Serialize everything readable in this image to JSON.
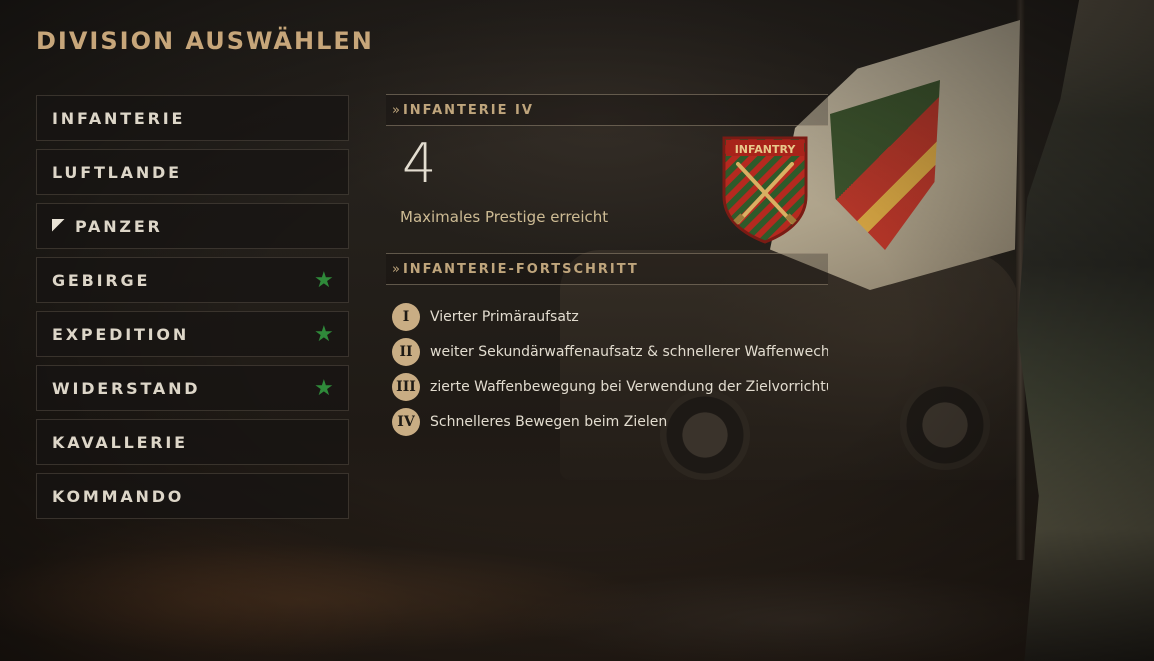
{
  "page": {
    "title": "DIVISION AUSWÄHLEN"
  },
  "menu": {
    "items": [
      {
        "label": "INFANTERIE",
        "selected": false,
        "starred": false
      },
      {
        "label": "LUFTLANDE",
        "selected": false,
        "starred": false
      },
      {
        "label": "PANZER",
        "selected": true,
        "starred": false
      },
      {
        "label": "GEBIRGE",
        "selected": false,
        "starred": true
      },
      {
        "label": "EXPEDITION",
        "selected": false,
        "starred": true
      },
      {
        "label": "WIDERSTAND",
        "selected": false,
        "starred": true
      },
      {
        "label": "KAVALLERIE",
        "selected": false,
        "starred": false
      },
      {
        "label": "KOMMANDO",
        "selected": false,
        "starred": false
      }
    ]
  },
  "detail": {
    "header": "INFANTERIE IV",
    "level": "4",
    "prestige_status": "Maximales Prestige erreicht",
    "badge": {
      "text": "INFANTRY",
      "icon": "crossed-rifles-icon"
    },
    "progress_header": "INFANTERIE-FORTSCHRITT",
    "perks": [
      {
        "numeral": "I",
        "text": "Vierter Primäraufsatz"
      },
      {
        "numeral": "II",
        "text": "weiter Sekundärwaffenaufsatz & schnellerer Waffenwechs"
      },
      {
        "numeral": "III",
        "text": "zierte Waffenbewegung bei Verwendung der Zielvorrichtun"
      },
      {
        "numeral": "IV",
        "text": "Schnelleres Bewegen beim Zielen"
      }
    ]
  },
  "colors": {
    "accent": "#c7a67a",
    "star": "#2f8a3a",
    "badge_red": "#b5291f",
    "badge_green": "#2f5a2a"
  }
}
